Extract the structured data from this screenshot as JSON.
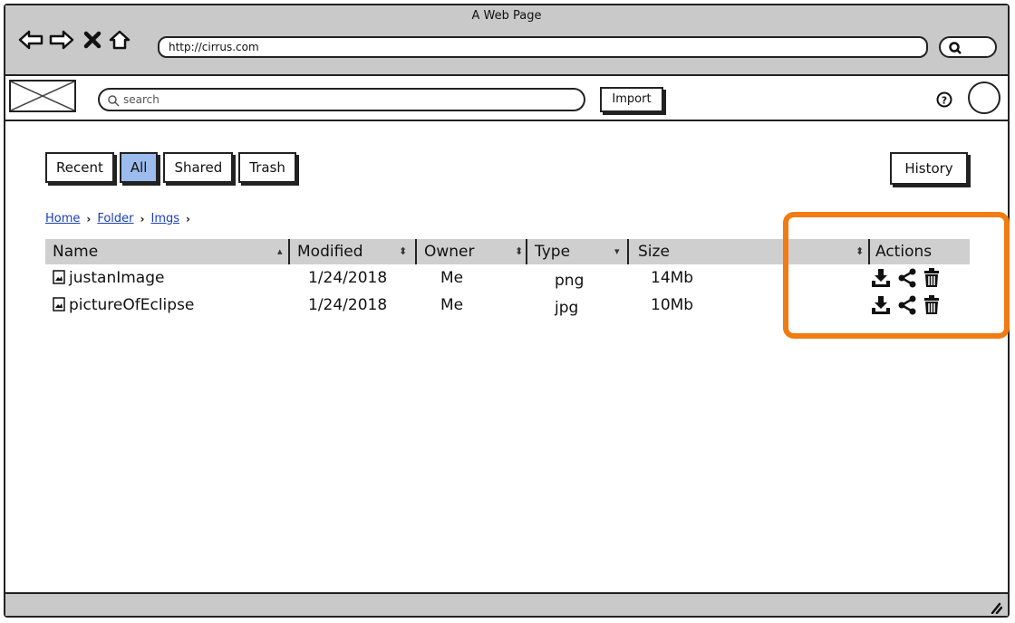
{
  "window": {
    "title": "A Web Page"
  },
  "address_bar": {
    "url": "http://cirrus.com",
    "nav_icons": [
      "back-arrow-icon",
      "forward-arrow-icon",
      "close-x-icon",
      "home-icon"
    ],
    "search_icon": "search-icon"
  },
  "toolbar": {
    "logo_icon": "image-placeholder-icon",
    "search_placeholder": "search",
    "import_label": "Import",
    "help_icon": "help-icon",
    "avatar_icon": "avatar"
  },
  "tabs": [
    {
      "label": "Recent",
      "selected": false
    },
    {
      "label": "All",
      "selected": true
    },
    {
      "label": "Shared",
      "selected": false
    },
    {
      "label": "Trash",
      "selected": false
    }
  ],
  "history_label": "History",
  "breadcrumb": {
    "items": [
      "Home",
      "Folder",
      "Imgs"
    ]
  },
  "table": {
    "columns": [
      "Name",
      "Modified",
      "Owner",
      "Type",
      "Size",
      "Actions"
    ],
    "rows": [
      {
        "name": "justanImage",
        "modified": "1/24/2018",
        "owner": "Me",
        "type": "png",
        "size": "14Mb"
      },
      {
        "name": "pictureOfEclipse",
        "modified": "1/24/2018",
        "owner": "Me",
        "type": "jpg",
        "size": "10Mb"
      }
    ],
    "action_icons": [
      "download-icon",
      "share-icon",
      "trash-icon"
    ]
  },
  "colors": {
    "selected_tab": "#9bbcec",
    "highlight": "#f07c12",
    "chrome": "#c9c9c9"
  }
}
